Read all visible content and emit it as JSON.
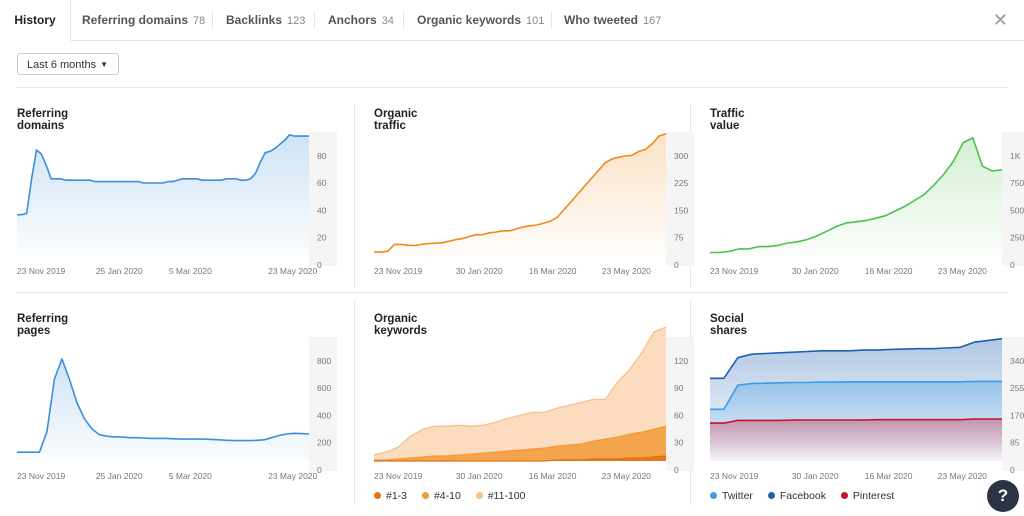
{
  "tabs": [
    {
      "label": "History",
      "count": ""
    },
    {
      "label": "Referring domains",
      "count": "78"
    },
    {
      "label": "Backlinks",
      "count": "123"
    },
    {
      "label": "Anchors",
      "count": "34"
    },
    {
      "label": "Organic keywords",
      "count": "101"
    },
    {
      "label": "Who tweeted",
      "count": "167"
    }
  ],
  "close_icon": "close-icon",
  "range": {
    "label": "Last 6 months"
  },
  "help": {
    "label": "?"
  },
  "colors": {
    "blue": "#3d8fd8",
    "orange": "#f08a1c",
    "green": "#4fbf4f",
    "darkblue": "#1e5fb0",
    "red": "#c8102e",
    "lightorange": "#f8c08a"
  },
  "chart_data": [
    {
      "title": "Referring domains",
      "type": "area",
      "color": "#3d8fd8",
      "xticks": [
        "23 Nov 2019",
        "25 Jan 2020",
        "5 Mar 2020",
        "23 May 2020"
      ],
      "yticks": [
        "80",
        "60",
        "40",
        "20",
        "0"
      ],
      "ylim": [
        0,
        90
      ],
      "series": [
        {
          "values": [
            30,
            30,
            31,
            56,
            77,
            74,
            66,
            56,
            56,
            56,
            55,
            55,
            55,
            55,
            55,
            55,
            54,
            54,
            54,
            54,
            54,
            54,
            54,
            54,
            54,
            54,
            53,
            53,
            53,
            53,
            53,
            54,
            54,
            55,
            56,
            56,
            56,
            56,
            55,
            55,
            55,
            55,
            55,
            56,
            56,
            56,
            55,
            55,
            56,
            60,
            68,
            75,
            76,
            78,
            81,
            84,
            88,
            87,
            87,
            87,
            87
          ]
        }
      ]
    },
    {
      "title": "Organic traffic",
      "type": "area",
      "color": "#f08a1c",
      "xticks": [
        "23 Nov 2019",
        "30 Jan 2020",
        "16 Mar 2020",
        "23 May 2020"
      ],
      "yticks": [
        "300",
        "225",
        "150",
        "75",
        "0"
      ],
      "ylim": [
        0,
        320
      ],
      "series": [
        {
          "values": [
            10,
            10,
            12,
            30,
            30,
            28,
            27,
            30,
            32,
            33,
            34,
            38,
            42,
            45,
            50,
            55,
            55,
            60,
            62,
            65,
            65,
            70,
            75,
            78,
            80,
            85,
            90,
            100,
            120,
            140,
            160,
            180,
            200,
            220,
            240,
            250,
            255,
            258,
            260,
            270,
            275,
            290,
            310,
            315
          ]
        }
      ]
    },
    {
      "title": "Traffic value",
      "type": "area",
      "color": "#4fbf4f",
      "xticks": [
        "23 Nov 2019",
        "30 Jan 2020",
        "16 Mar 2020",
        "23 May 2020"
      ],
      "yticks": [
        "1K",
        "750",
        "500",
        "250",
        "0"
      ],
      "ylim": [
        0,
        1050
      ],
      "series": [
        {
          "values": [
            30,
            30,
            40,
            60,
            60,
            80,
            80,
            90,
            110,
            120,
            140,
            170,
            210,
            250,
            280,
            290,
            300,
            320,
            340,
            380,
            420,
            470,
            520,
            600,
            690,
            800,
            960,
            1000,
            760,
            720,
            730
          ]
        }
      ]
    },
    {
      "title": "Referring pages",
      "type": "area",
      "color": "#3d8fd8",
      "xticks": [
        "23 Nov 2019",
        "25 Jan 2020",
        "5 Mar 2020",
        "23 May 2020"
      ],
      "yticks": [
        "800",
        "600",
        "400",
        "200",
        "0"
      ],
      "ylim": [
        0,
        850
      ],
      "series": [
        {
          "values": [
            60,
            60,
            60,
            60,
            200,
            560,
            700,
            560,
            400,
            290,
            220,
            180,
            170,
            165,
            165,
            160,
            160,
            158,
            155,
            155,
            155,
            152,
            150,
            150,
            150,
            150,
            148,
            145,
            142,
            140,
            140,
            140,
            142,
            145,
            160,
            175,
            185,
            190,
            188,
            185
          ]
        }
      ]
    },
    {
      "title": "Organic keywords",
      "type": "stacked-area",
      "xticks": [
        "23 Nov 2019",
        "30 Jan 2020",
        "16 Mar 2020",
        "23 May 2020"
      ],
      "yticks": [
        "120",
        "90",
        "60",
        "30",
        "0"
      ],
      "ylim": [
        0,
        125
      ],
      "series": [
        {
          "name": "#1-3",
          "color": "#e5700f",
          "values": [
            0,
            0,
            0,
            0,
            0,
            0,
            0,
            0,
            0,
            0,
            0,
            0,
            0,
            0,
            0,
            1,
            1,
            1,
            2,
            2,
            2,
            3,
            3,
            4,
            5
          ]
        },
        {
          "name": "#4-10",
          "color": "#f39a3a",
          "values": [
            1,
            1,
            2,
            3,
            4,
            5,
            5,
            6,
            7,
            8,
            9,
            10,
            11,
            12,
            13,
            14,
            15,
            16,
            18,
            20,
            22,
            24,
            26,
            28,
            30
          ]
        },
        {
          "name": "#11-100",
          "color": "#f8c08a",
          "values": [
            5,
            8,
            12,
            22,
            28,
            30,
            30,
            30,
            28,
            28,
            30,
            33,
            35,
            37,
            36,
            38,
            40,
            42,
            42,
            40,
            55,
            65,
            80,
            98,
            100
          ]
        }
      ],
      "legend": [
        "#1-3",
        "#4-10",
        "#11-100"
      ]
    },
    {
      "title": "Social shares",
      "type": "area",
      "xticks": [
        "23 Nov 2019",
        "30 Jan 2020",
        "16 Mar 2020",
        "23 May 2020"
      ],
      "yticks": [
        "340",
        "255",
        "170",
        "85",
        "0"
      ],
      "ylim": [
        0,
        360
      ],
      "series": [
        {
          "name": "Facebook",
          "color": "#1e5fb0",
          "values": [
            240,
            240,
            300,
            310,
            312,
            314,
            316,
            318,
            320,
            320,
            320,
            322,
            322,
            324,
            325,
            326,
            326,
            328,
            330,
            345,
            350,
            355
          ]
        },
        {
          "name": "Twitter",
          "color": "#3d9be9",
          "values": [
            150,
            150,
            220,
            225,
            226,
            227,
            228,
            228,
            229,
            229,
            230,
            230,
            230,
            230,
            230,
            230,
            230,
            230,
            230,
            231,
            231,
            231
          ]
        },
        {
          "name": "Pinterest",
          "color": "#c8102e",
          "values": [
            110,
            110,
            118,
            118,
            118,
            118,
            119,
            119,
            119,
            119,
            119,
            119,
            120,
            120,
            120,
            120,
            120,
            120,
            120,
            122,
            122,
            122
          ]
        }
      ],
      "legend": [
        "Twitter",
        "Facebook",
        "Pinterest"
      ]
    }
  ]
}
